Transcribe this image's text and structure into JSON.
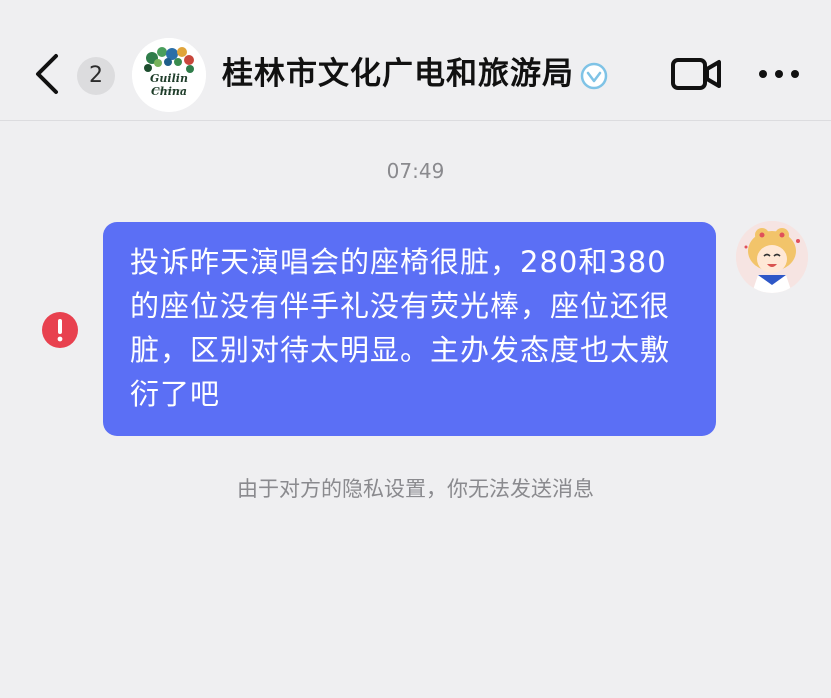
{
  "header": {
    "back_icon": "chevron-left-icon",
    "unread_count": "2",
    "avatar_text": "Guilin China",
    "title": "桂林市文化广电和旅游局",
    "verified_icon": "verified-badge-icon",
    "video_icon": "video-camera-icon",
    "more_icon": "more-dots-icon"
  },
  "chat": {
    "timestamp": "07:49",
    "message": "投诉昨天演唱会的座椅很脏，280和380的座位没有伴手礼没有荧光棒，座位还很脏，区别对待太明显。主办发态度也太敷衍了吧",
    "send_status_icon": "send-failed-icon",
    "privacy_notice": "由于对方的隐私设置，你无法发送消息"
  },
  "colors": {
    "background": "#efeff1",
    "bubble": "#5b6ff5",
    "error": "#e8414f",
    "verified": "#7fc3e6"
  }
}
